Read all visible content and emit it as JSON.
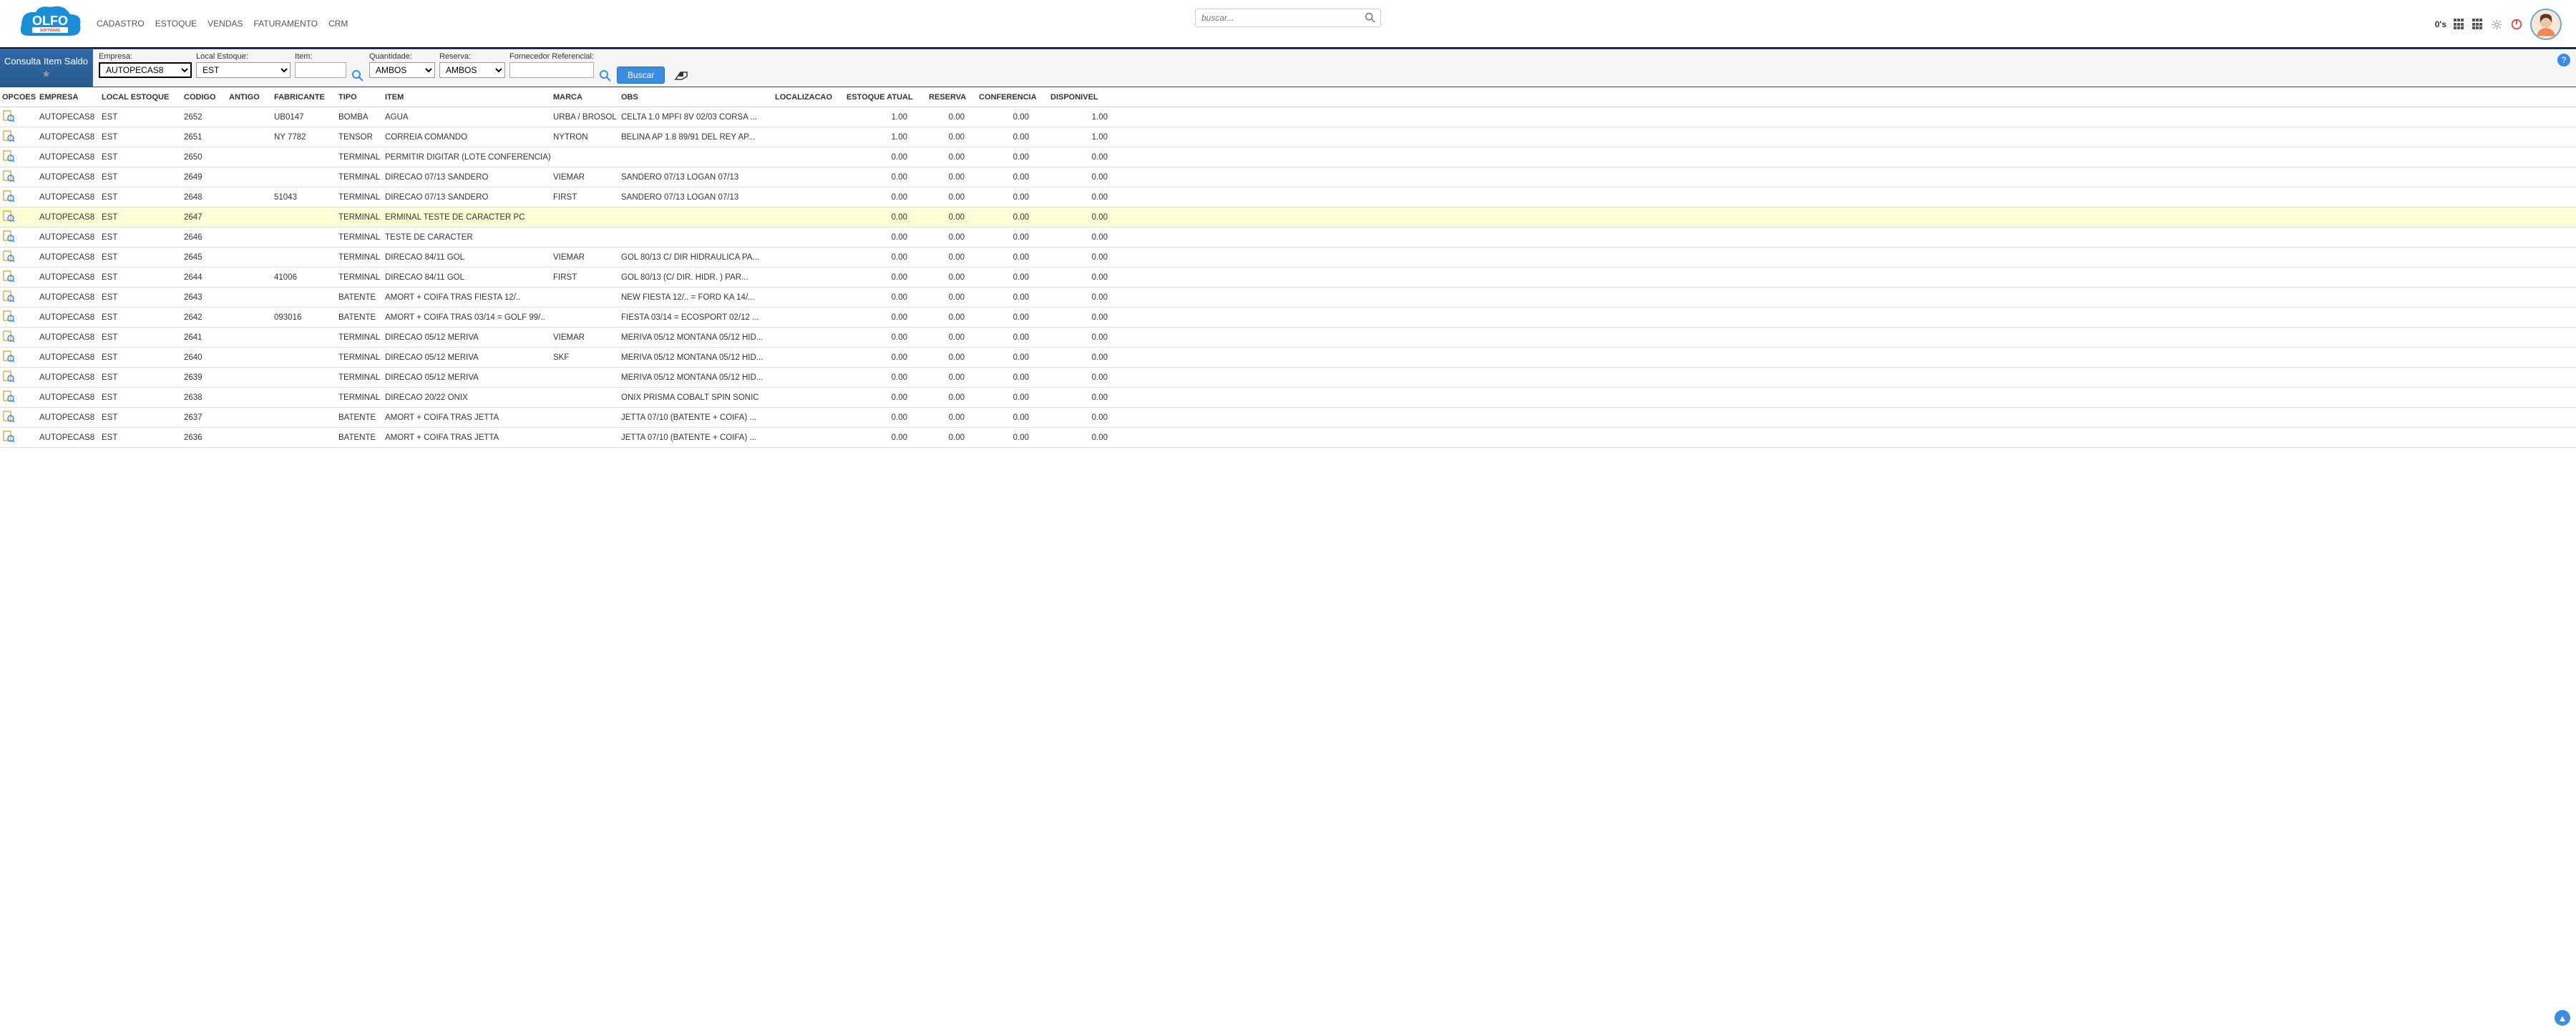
{
  "header": {
    "menu": [
      "CADASTRO",
      "ESTOQUE",
      "VENDAS",
      "FATURAMENTO",
      "CRM"
    ],
    "search_placeholder": "buscar...",
    "os_label": "0's"
  },
  "filter": {
    "title": "Consulta Item Saldo",
    "labels": {
      "empresa": "Empresa:",
      "local": "Local Estoque:",
      "item": "Item:",
      "qtd": "Quantidade:",
      "reserva": "Reserva:",
      "forn": "Fornecedor Referencial:"
    },
    "values": {
      "empresa": "AUTOPECAS8",
      "local": "EST",
      "item": "",
      "qtd": "AMBOS",
      "reserva": "AMBOS",
      "forn": ""
    },
    "buscar": "Buscar"
  },
  "columns": [
    "OPCOES",
    "EMPRESA",
    "LOCAL ESTOQUE",
    "CODIGO",
    "ANTIGO",
    "FABRICANTE",
    "TIPO",
    "ITEM",
    "MARCA",
    "OBS",
    "LOCALIZACAO",
    "ESTOQUE ATUAL",
    "RESERVA",
    "CONFERENCIA",
    "DISPONIVEL"
  ],
  "rows": [
    {
      "emp": "AUTOPECAS8",
      "loc": "EST",
      "cod": "2652",
      "ant": "",
      "fab": "UB0147",
      "tip": "BOMBA",
      "itm": "AGUA",
      "mar": "URBA / BROSOL",
      "obs": "CELTA 1.0 MPFI 8V 02/03 CORSA ...",
      "lcz": "",
      "est": "1.00",
      "res": "0.00",
      "con": "0.00",
      "dis": "1.00",
      "hl": false
    },
    {
      "emp": "AUTOPECAS8",
      "loc": "EST",
      "cod": "2651",
      "ant": "",
      "fab": "NY 7782",
      "tip": "TENSOR",
      "itm": "CORREIA COMANDO",
      "mar": "NYTRON",
      "obs": "BELINA AP 1.8 89/91 DEL REY AP...",
      "lcz": "",
      "est": "1.00",
      "res": "0.00",
      "con": "0.00",
      "dis": "1.00",
      "hl": false
    },
    {
      "emp": "AUTOPECAS8",
      "loc": "EST",
      "cod": "2650",
      "ant": "",
      "fab": "",
      "tip": "TERMINAL",
      "itm": "PERMITIR DIGITAR (LOTE CONFERENCIA)",
      "mar": "",
      "obs": "",
      "lcz": "",
      "est": "0.00",
      "res": "0.00",
      "con": "0.00",
      "dis": "0.00",
      "hl": false
    },
    {
      "emp": "AUTOPECAS8",
      "loc": "EST",
      "cod": "2649",
      "ant": "",
      "fab": "",
      "tip": "TERMINAL",
      "itm": "DIRECAO 07/13 SANDERO",
      "mar": "VIEMAR",
      "obs": "SANDERO 07/13 LOGAN 07/13",
      "lcz": "",
      "est": "0.00",
      "res": "0.00",
      "con": "0.00",
      "dis": "0.00",
      "hl": false
    },
    {
      "emp": "AUTOPECAS8",
      "loc": "EST",
      "cod": "2648",
      "ant": "",
      "fab": "51043",
      "tip": "TERMINAL",
      "itm": "DIRECAO 07/13 SANDERO",
      "mar": "FIRST",
      "obs": "SANDERO 07/13 LOGAN 07/13",
      "lcz": "",
      "est": "0.00",
      "res": "0.00",
      "con": "0.00",
      "dis": "0.00",
      "hl": false
    },
    {
      "emp": "AUTOPECAS8",
      "loc": "EST",
      "cod": "2647",
      "ant": "",
      "fab": "",
      "tip": "TERMINAL",
      "itm": "ERMINAL TESTE DE CARACTER PC",
      "mar": "",
      "obs": "",
      "lcz": "",
      "est": "0.00",
      "res": "0.00",
      "con": "0.00",
      "dis": "0.00",
      "hl": true
    },
    {
      "emp": "AUTOPECAS8",
      "loc": "EST",
      "cod": "2646",
      "ant": "",
      "fab": "",
      "tip": "TERMINAL",
      "itm": "TESTE DE CARACTER",
      "mar": "",
      "obs": "",
      "lcz": "",
      "est": "0.00",
      "res": "0.00",
      "con": "0.00",
      "dis": "0.00",
      "hl": false
    },
    {
      "emp": "AUTOPECAS8",
      "loc": "EST",
      "cod": "2645",
      "ant": "",
      "fab": "",
      "tip": "TERMINAL",
      "itm": " DIRECAO 84/11 GOL",
      "mar": "VIEMAR",
      "obs": "GOL 80/13 C/ DIR HIDRAULICA PA...",
      "lcz": "",
      "est": "0.00",
      "res": "0.00",
      "con": "0.00",
      "dis": "0.00",
      "hl": false
    },
    {
      "emp": "AUTOPECAS8",
      "loc": "EST",
      "cod": "2644",
      "ant": "",
      "fab": "41006",
      "tip": "TERMINAL",
      "itm": "DIRECAO 84/11 GOL",
      "mar": "FIRST",
      "obs": "GOL 80/13 (C/ DIR. HIDR. ) PAR...",
      "lcz": "",
      "est": "0.00",
      "res": "0.00",
      "con": "0.00",
      "dis": "0.00",
      "hl": false
    },
    {
      "emp": "AUTOPECAS8",
      "loc": "EST",
      "cod": "2643",
      "ant": "",
      "fab": "",
      "tip": "BATENTE",
      "itm": "AMORT + COIFA TRAS FIESTA 12/..",
      "mar": "",
      "obs": "NEW FIESTA 12/.. = FORD KA 14/...",
      "lcz": "",
      "est": "0.00",
      "res": "0.00",
      "con": "0.00",
      "dis": "0.00",
      "hl": false
    },
    {
      "emp": "AUTOPECAS8",
      "loc": "EST",
      "cod": "2642",
      "ant": "",
      "fab": "093016",
      "tip": "BATENTE",
      "itm": "AMORT + COIFA TRAS 03/14 = GOLF 99/..",
      "mar": "",
      "obs": "FIESTA 03/14 = ECOSPORT 02/12 ...",
      "lcz": "",
      "est": "0.00",
      "res": "0.00",
      "con": "0.00",
      "dis": "0.00",
      "hl": false
    },
    {
      "emp": "AUTOPECAS8",
      "loc": "EST",
      "cod": "2641",
      "ant": "",
      "fab": "",
      "tip": "TERMINAL",
      "itm": "DIRECAO 05/12 MERIVA",
      "mar": "VIEMAR",
      "obs": "MERIVA 05/12 MONTANA 05/12 HID...",
      "lcz": "",
      "est": "0.00",
      "res": "0.00",
      "con": "0.00",
      "dis": "0.00",
      "hl": false
    },
    {
      "emp": "AUTOPECAS8",
      "loc": "EST",
      "cod": "2640",
      "ant": "",
      "fab": "",
      "tip": "TERMINAL",
      "itm": "DIRECAO 05/12 MERIVA",
      "mar": "SKF",
      "obs": "MERIVA 05/12 MONTANA 05/12 HID...",
      "lcz": "",
      "est": "0.00",
      "res": "0.00",
      "con": "0.00",
      "dis": "0.00",
      "hl": false
    },
    {
      "emp": "AUTOPECAS8",
      "loc": "EST",
      "cod": "2639",
      "ant": "",
      "fab": "",
      "tip": "TERMINAL",
      "itm": "DIRECAO 05/12 MERIVA",
      "mar": "",
      "obs": "MERIVA 05/12 MONTANA 05/12 HID...",
      "lcz": "",
      "est": "0.00",
      "res": "0.00",
      "con": "0.00",
      "dis": "0.00",
      "hl": false
    },
    {
      "emp": "AUTOPECAS8",
      "loc": "EST",
      "cod": "2638",
      "ant": "",
      "fab": "",
      "tip": "TERMINAL",
      "itm": "DIRECAO 20/22 ONIX",
      "mar": "",
      "obs": "ONIX PRISMA COBALT SPIN SONIC",
      "lcz": "",
      "est": "0.00",
      "res": "0.00",
      "con": "0.00",
      "dis": "0.00",
      "hl": false
    },
    {
      "emp": "AUTOPECAS8",
      "loc": "EST",
      "cod": "2637",
      "ant": "",
      "fab": "",
      "tip": "BATENTE",
      "itm": "AMORT + COIFA TRAS JETTA",
      "mar": "",
      "obs": "JETTA 07/10 (BATENTE + COIFA) ...",
      "lcz": "",
      "est": "0.00",
      "res": "0.00",
      "con": "0.00",
      "dis": "0.00",
      "hl": false
    },
    {
      "emp": "AUTOPECAS8",
      "loc": "EST",
      "cod": "2636",
      "ant": "",
      "fab": "",
      "tip": "BATENTE",
      "itm": "AMORT + COIFA TRAS JETTA",
      "mar": "",
      "obs": "JETTA 07/10 (BATENTE + COIFA) ...",
      "lcz": "",
      "est": "0.00",
      "res": "0.00",
      "con": "0.00",
      "dis": "0.00",
      "hl": false
    }
  ]
}
